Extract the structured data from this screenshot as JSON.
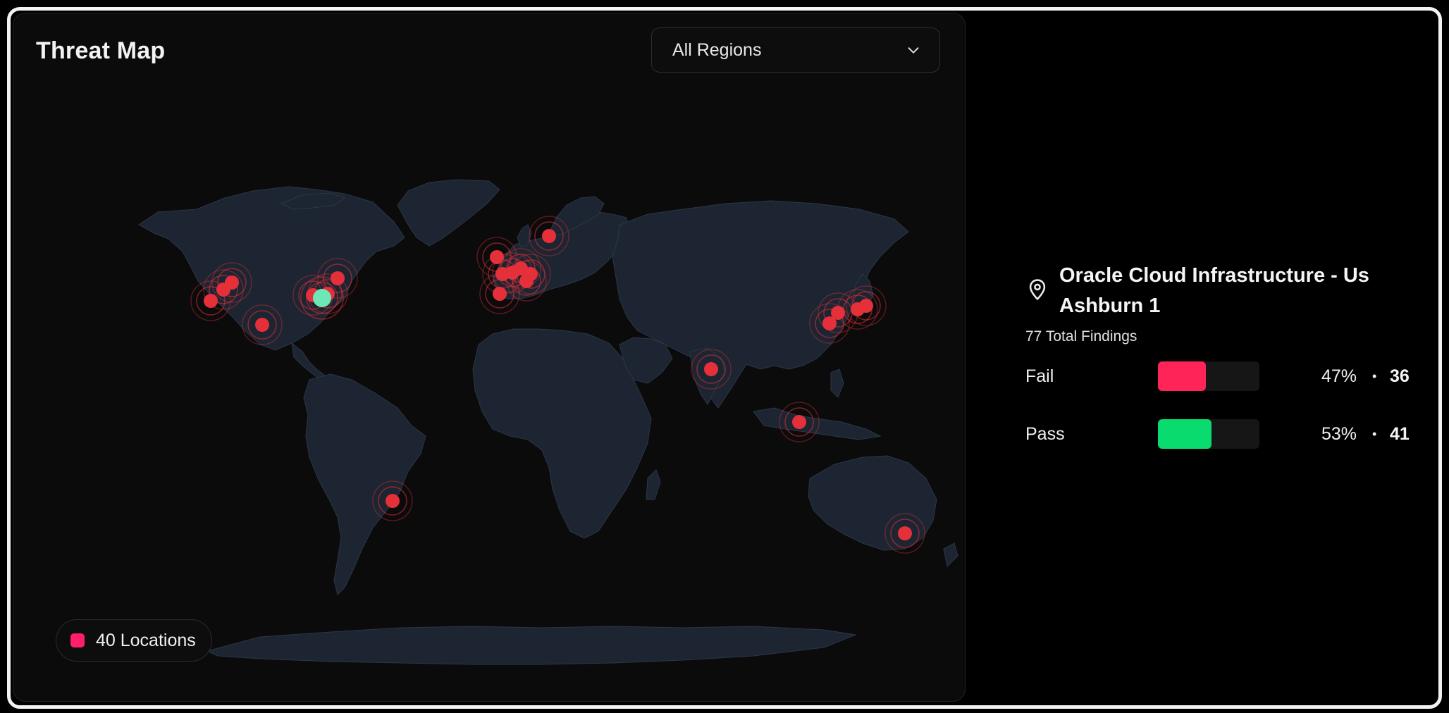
{
  "threat_map": {
    "title": "Threat Map",
    "region_filter": {
      "selected": "All Regions"
    },
    "legend": {
      "count_label": "40 Locations",
      "color": "#ff1f6e"
    },
    "colors": {
      "land": "#1c2531",
      "fail_marker": "#e5303a",
      "selected_marker": "#6ee7b7"
    }
  },
  "selected_location": {
    "name": "Oracle Cloud Infrastructure - Us Ashburn 1",
    "total_findings": "77 Total Findings",
    "stats": [
      {
        "label": "Fail",
        "percent_text": "47%",
        "separator": "•",
        "count": "36",
        "fraction": 0.47,
        "color": "#ff2457"
      },
      {
        "label": "Pass",
        "percent_text": "53%",
        "separator": "•",
        "count": "41",
        "fraction": 0.53,
        "color": "#09db6f"
      }
    ]
  }
}
